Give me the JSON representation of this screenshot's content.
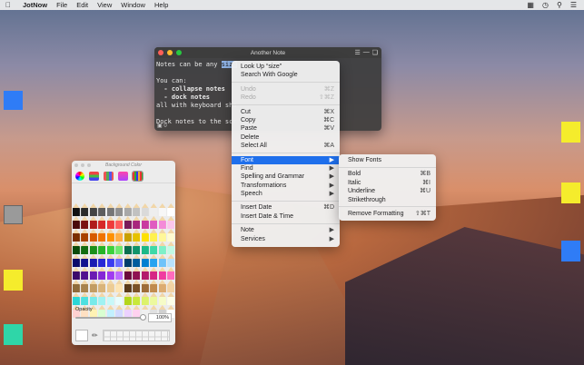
{
  "menubar": {
    "app_name": "JotNow",
    "items": [
      "File",
      "Edit",
      "View",
      "Window",
      "Help"
    ],
    "status_icons": [
      "battery-icon",
      "clock-icon",
      "search-icon",
      "list-icon"
    ]
  },
  "note": {
    "title": "Another Note",
    "lines": [
      "Notes can be any ",
      "size",
      "",
      "You can:",
      "  - collapse notes",
      "  - dock notes",
      "all with keyboard sho",
      "",
      "Dock notes to the scr"
    ],
    "footer": "0"
  },
  "color_panel": {
    "title": "Background Color",
    "opacity_label": "Opacity",
    "opacity_value": "100%",
    "opacity_fraction": 1.0
  },
  "context_menu": {
    "items": [
      {
        "label": "Look Up “size”",
        "shortcut": "",
        "state": "normal"
      },
      {
        "label": "Search With Google",
        "shortcut": "",
        "state": "normal"
      },
      {
        "sep": true
      },
      {
        "label": "Undo",
        "shortcut": "⌘Z",
        "state": "disabled"
      },
      {
        "label": "Redo",
        "shortcut": "⇧⌘Z",
        "state": "disabled"
      },
      {
        "sep": true
      },
      {
        "label": "Cut",
        "shortcut": "⌘X",
        "state": "normal"
      },
      {
        "label": "Copy",
        "shortcut": "⌘C",
        "state": "normal"
      },
      {
        "label": "Paste",
        "shortcut": "⌘V",
        "state": "normal"
      },
      {
        "label": "Delete",
        "shortcut": "",
        "state": "normal"
      },
      {
        "label": "Select All",
        "shortcut": "⌘A",
        "state": "normal"
      },
      {
        "sep": true
      },
      {
        "label": "Font",
        "shortcut": "▶",
        "state": "highlight"
      },
      {
        "label": "Find",
        "shortcut": "▶",
        "state": "normal"
      },
      {
        "label": "Spelling and Grammar",
        "shortcut": "▶",
        "state": "normal"
      },
      {
        "label": "Transformations",
        "shortcut": "▶",
        "state": "normal"
      },
      {
        "label": "Speech",
        "shortcut": "▶",
        "state": "normal"
      },
      {
        "sep": true
      },
      {
        "label": "Insert Date",
        "shortcut": "⌘D",
        "state": "normal"
      },
      {
        "label": "Insert Date & Time",
        "shortcut": "",
        "state": "normal"
      },
      {
        "sep": true
      },
      {
        "label": "Note",
        "shortcut": "▶",
        "state": "normal"
      },
      {
        "label": "Services",
        "shortcut": "▶",
        "state": "normal"
      }
    ]
  },
  "font_submenu": {
    "items": [
      {
        "label": "Show Fonts",
        "shortcut": ""
      },
      {
        "sep": true
      },
      {
        "label": "Bold",
        "shortcut": "⌘B"
      },
      {
        "label": "Italic",
        "shortcut": "⌘I"
      },
      {
        "label": "Underline",
        "shortcut": "⌘U"
      },
      {
        "label": "Strikethrough",
        "shortcut": ""
      },
      {
        "sep": true
      },
      {
        "label": "Remove Formatting",
        "shortcut": "⇧⌘T"
      }
    ]
  },
  "colors": {
    "accent": "#1f6feb",
    "sticky_blue": "#2f7cf6",
    "sticky_yellow": "#f5ec2c",
    "sticky_green": "#2fd6a8",
    "sticky_gray": "#9a9a9a",
    "pencils": [
      "#1a1a1a",
      "#4a4a4a",
      "#7a7a7a",
      "#a0a0a0",
      "#c8c8c8",
      "#e8e8e8",
      "#6b3a20",
      "#8b5a2b",
      "#d8b27a",
      "#f4d9a8",
      "#f6e9c8",
      "#ffffff"
    ]
  }
}
